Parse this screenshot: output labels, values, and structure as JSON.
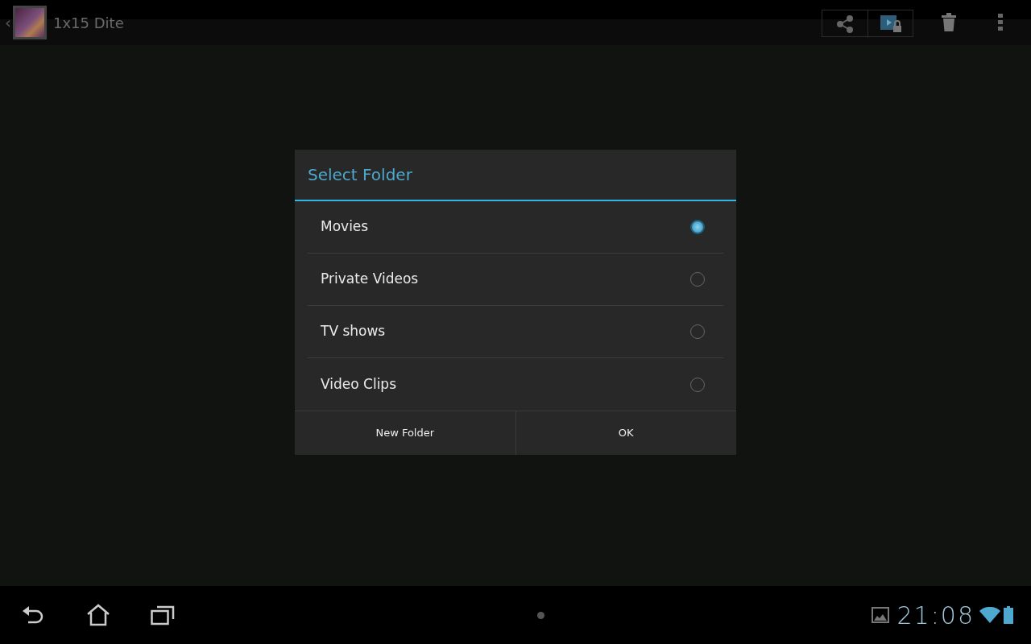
{
  "action_bar": {
    "back": "‹",
    "title": "1x15 Dite"
  },
  "dialog": {
    "title": "Select Folder",
    "options": [
      {
        "label": "Movies",
        "selected": true
      },
      {
        "label": "Private Videos",
        "selected": false
      },
      {
        "label": "TV shows",
        "selected": false
      },
      {
        "label": "Video Clips",
        "selected": false
      }
    ],
    "buttons": [
      "New Folder",
      "OK"
    ]
  },
  "status_bar": {
    "time": "21:08"
  }
}
